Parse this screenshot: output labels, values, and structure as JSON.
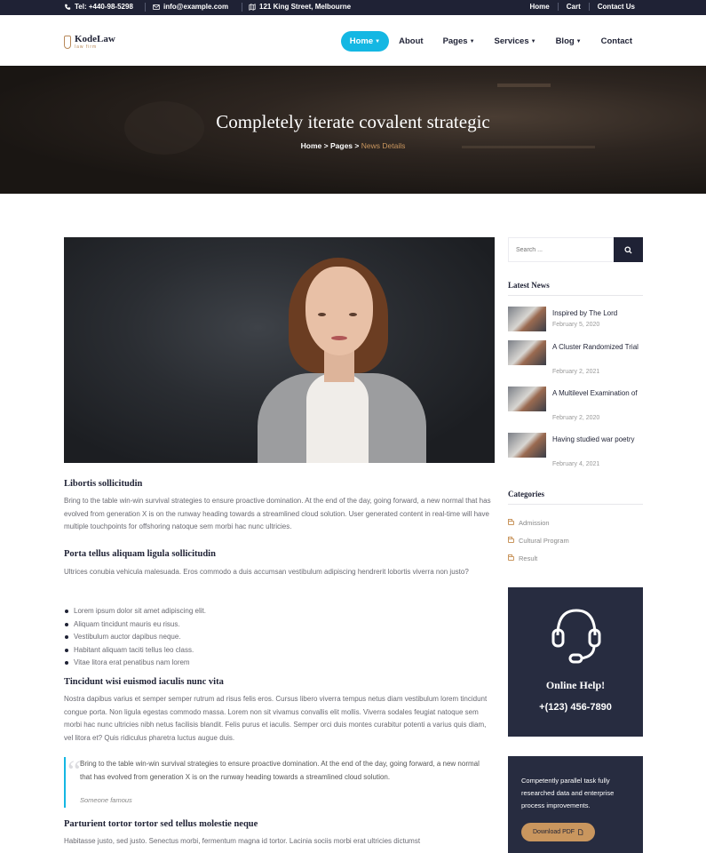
{
  "topbar": {
    "phone": "Tel: +440-98-5298",
    "email": "info@example.com",
    "address": "121 King Street, Melbourne",
    "links": [
      "Home",
      "Cart",
      "Contact Us"
    ]
  },
  "logo": {
    "name": "KodeLaw",
    "tagline": "law firm"
  },
  "nav": {
    "items": [
      {
        "label": "Home",
        "dropdown": true
      },
      {
        "label": "About",
        "dropdown": false
      },
      {
        "label": "Pages",
        "dropdown": true
      },
      {
        "label": "Services",
        "dropdown": true
      },
      {
        "label": "Blog",
        "dropdown": true
      },
      {
        "label": "Contact",
        "dropdown": false
      }
    ],
    "active": "Home"
  },
  "hero": {
    "title": "Completely iterate covalent strategic",
    "breadcrumb": [
      "Home",
      "Pages",
      "News Details"
    ],
    "separator": ">"
  },
  "article": {
    "sections": [
      {
        "heading": "Libortis sollicitudin",
        "body": "Bring to the table win-win survival strategies to ensure proactive domination. At the end of the day, going forward, a new normal that has evolved from generation X is on the runway heading towards a streamlined cloud solution. User generated content in real-time will have multiple touchpoints for offshoring natoque sem morbi hac nunc ultricies."
      },
      {
        "heading": "Porta tellus aliquam ligula sollicitudin",
        "body": "Ultrices conubia vehicula malesuada. Eros commodo a duis accumsan vestibulum adipiscing hendrerit lobortis viverra non justo?"
      },
      {
        "heading": "Tincidunt wisi euismod iaculis nunc vita",
        "body": "Nostra dapibus varius et semper semper rutrum ad risus felis eros. Cursus libero viverra tempus netus diam vestibulum lorem tincidunt congue porta. Non ligula egestas commodo massa. Lorem non sit vivamus convallis elit mollis. Viverra sodales feugiat natoque sem morbi hac nunc ultricies nibh netus facilisis blandit. Felis purus et iaculis. Semper orci duis montes curabitur potenti a varius quis diam, vel litora et? Quis ridiculus pharetra luctus augue duis."
      },
      {
        "heading": "Parturient tortor tortor sed tellus molestie neque",
        "body": "Habitasse justo, sed justo. Senectus morbi, fermentum magna id tortor. Lacinia sociis morbi erat ultricies dictumst"
      }
    ],
    "list": [
      "Lorem ipsum dolor sit amet adipiscing elit.",
      "Aliquam tincidunt mauris eu risus.",
      "Vestibulum auctor dapibus neque.",
      "Habitant aliquam taciti tellus leo class.",
      "Vitae litora erat penatibus nam lorem"
    ],
    "quote": {
      "text": "Bring to the table win-win survival strategies to ensure proactive domination. At the end of the day, going forward, a new normal that has evolved from generation X is on the runway heading towards a streamlined cloud solution.",
      "author": "Someone famous"
    }
  },
  "sidebar": {
    "search_placeholder": "Search ...",
    "latest_news_title": "Latest News",
    "news": [
      {
        "title": "Inspired by The Lord",
        "date": "February 5, 2020"
      },
      {
        "title": "A Cluster Randomized Trial",
        "date": "February 2, 2021"
      },
      {
        "title": "A Multilevel Examination of",
        "date": "February 2, 2020"
      },
      {
        "title": "Having studied war poetry",
        "date": "February 4, 2021"
      }
    ],
    "categories_title": "Categories",
    "categories": [
      "Admission",
      "Cultural Program",
      "Result"
    ],
    "help": {
      "title": "Online Help!",
      "phone": "+(123) 456-7890"
    },
    "pdf": {
      "text": "Competently parallel task fully researched data and enterprise process improvements.",
      "button": "Download PDF"
    }
  },
  "colors": {
    "navy": "#1f2235",
    "accent": "#14b7e3",
    "gold": "#c9965e",
    "panel": "#272c40"
  }
}
